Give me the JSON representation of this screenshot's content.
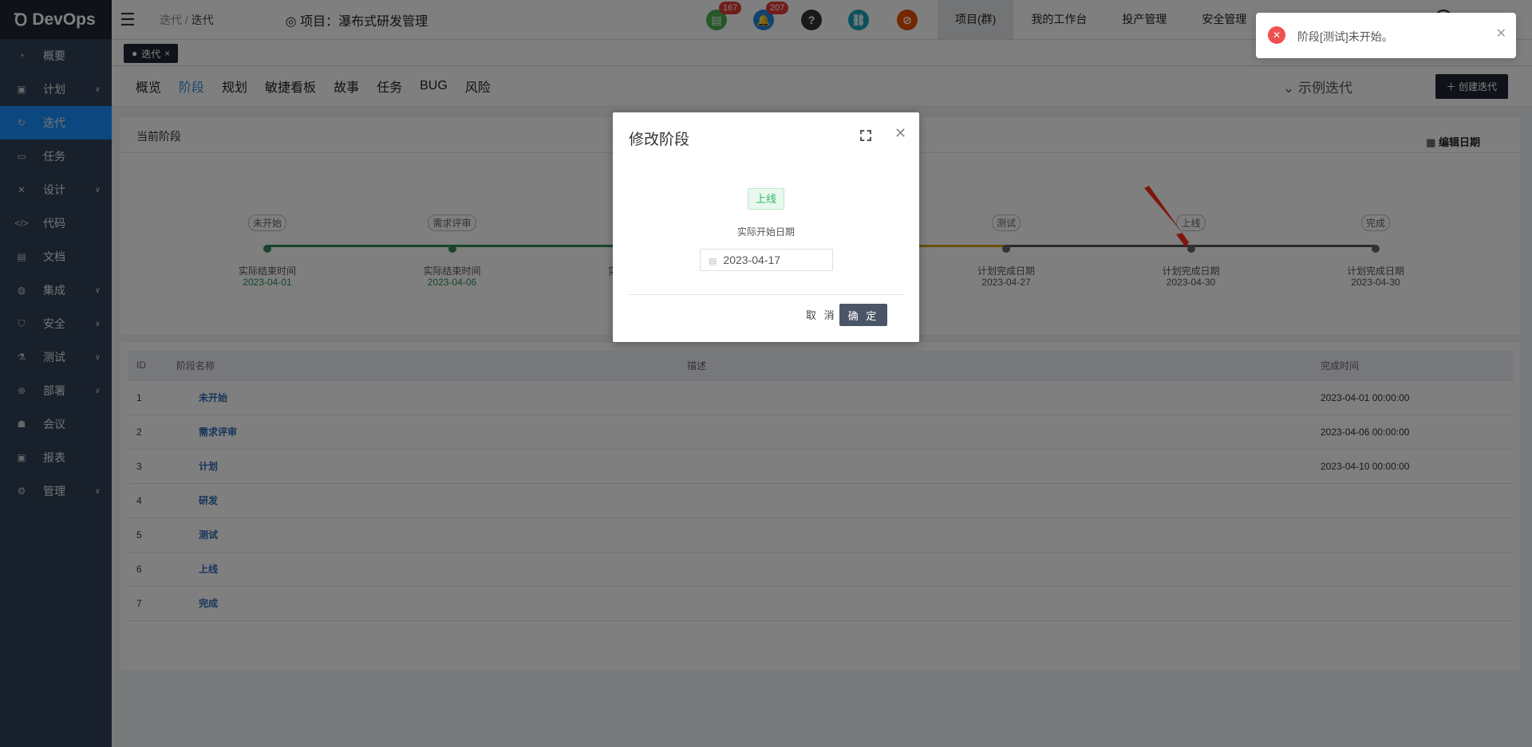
{
  "app": {
    "logo": "DevOps"
  },
  "sidebar": {
    "items": [
      {
        "label": "概要",
        "icon": "dashboard-icon",
        "expand": false
      },
      {
        "label": "计划",
        "icon": "plan-icon",
        "expand": true
      },
      {
        "label": "迭代",
        "icon": "iteration-icon",
        "expand": false,
        "active": true
      },
      {
        "label": "任务",
        "icon": "task-folder-icon",
        "expand": false
      },
      {
        "label": "设计",
        "icon": "design-tools-icon",
        "expand": true
      },
      {
        "label": "代码",
        "icon": "code-icon",
        "expand": false
      },
      {
        "label": "文档",
        "icon": "document-icon",
        "expand": false
      },
      {
        "label": "集成",
        "icon": "integration-icon",
        "expand": true
      },
      {
        "label": "安全",
        "icon": "shield-icon",
        "expand": true
      },
      {
        "label": "测试",
        "icon": "flask-icon",
        "expand": true
      },
      {
        "label": "部署",
        "icon": "crosshair-icon",
        "expand": true
      },
      {
        "label": "会议",
        "icon": "meeting-icon",
        "expand": false
      },
      {
        "label": "报表",
        "icon": "report-icon",
        "expand": false
      },
      {
        "label": "管理",
        "icon": "gear-icon",
        "expand": true
      }
    ]
  },
  "header": {
    "breadcrumb": [
      "迭代",
      "迭代"
    ],
    "project_title": "项目：瀑布式研发管理",
    "icons": [
      {
        "name": "doc-notice-icon",
        "badge": "167",
        "color": "#4caf50"
      },
      {
        "name": "bell-icon",
        "badge": "207",
        "color": "#1e88e5"
      },
      {
        "name": "help-icon",
        "color": "#333333"
      },
      {
        "name": "link-icon",
        "color": "#17a2b8"
      },
      {
        "name": "block-icon",
        "color": "#e65100"
      }
    ],
    "nav": [
      "项目(群)",
      "我的工作台",
      "投产管理",
      "安全管理"
    ]
  },
  "tabs": [
    {
      "label": "迭代",
      "close": "×"
    }
  ],
  "subnav": {
    "items": [
      "概览",
      "阶段",
      "规划",
      "敏捷看板",
      "故事",
      "任务",
      "BUG",
      "风险"
    ],
    "active": "阶段",
    "iteration": "示例迭代",
    "create_label": "创建迭代"
  },
  "stage_card": {
    "title": "当前阶段",
    "edit_date": "编辑日期",
    "stages": [
      {
        "name": "未开始",
        "caption": "实际结束时间",
        "date": "2023-04-01",
        "status": "done"
      },
      {
        "name": "需求评审",
        "caption": "实际结束时间",
        "date": "2023-04-06",
        "status": "done"
      },
      {
        "name": "计划",
        "caption": "实际结束时间",
        "date": "2023-04-10",
        "status": "done"
      },
      {
        "name": "研发",
        "caption": "",
        "date": "",
        "status": "current"
      },
      {
        "name": "测试",
        "caption": "计划完成日期",
        "date": "2023-04-27",
        "status": "todo"
      },
      {
        "name": "上线",
        "caption": "计划完成日期",
        "date": "2023-04-30",
        "status": "todo"
      },
      {
        "name": "完成",
        "caption": "计划完成日期",
        "date": "2023-04-30",
        "status": "todo"
      }
    ],
    "colors": {
      "done": "#2e8b57",
      "current": "#d4a017",
      "todo": "#555555"
    }
  },
  "table": {
    "headers": [
      "ID",
      "阶段名称",
      "描述",
      "完成时间"
    ],
    "rows": [
      [
        "1",
        "未开始",
        "",
        "2023-04-01 00:00:00"
      ],
      [
        "2",
        "需求评审",
        "",
        "2023-04-06 00:00:00"
      ],
      [
        "3",
        "计划",
        "",
        "2023-04-10 00:00:00"
      ],
      [
        "4",
        "研发",
        "",
        ""
      ],
      [
        "5",
        "测试",
        "",
        ""
      ],
      [
        "6",
        "上线",
        "",
        ""
      ],
      [
        "7",
        "完成",
        "",
        ""
      ]
    ]
  },
  "modal": {
    "title": "修改阶段",
    "stage_tag": "上线",
    "date_label": "实际开始日期",
    "date_value": "2023-04-17",
    "cancel": "取 消",
    "confirm": "确 定"
  },
  "toast": {
    "message": "阶段[测试]未开始。",
    "type": "error"
  }
}
